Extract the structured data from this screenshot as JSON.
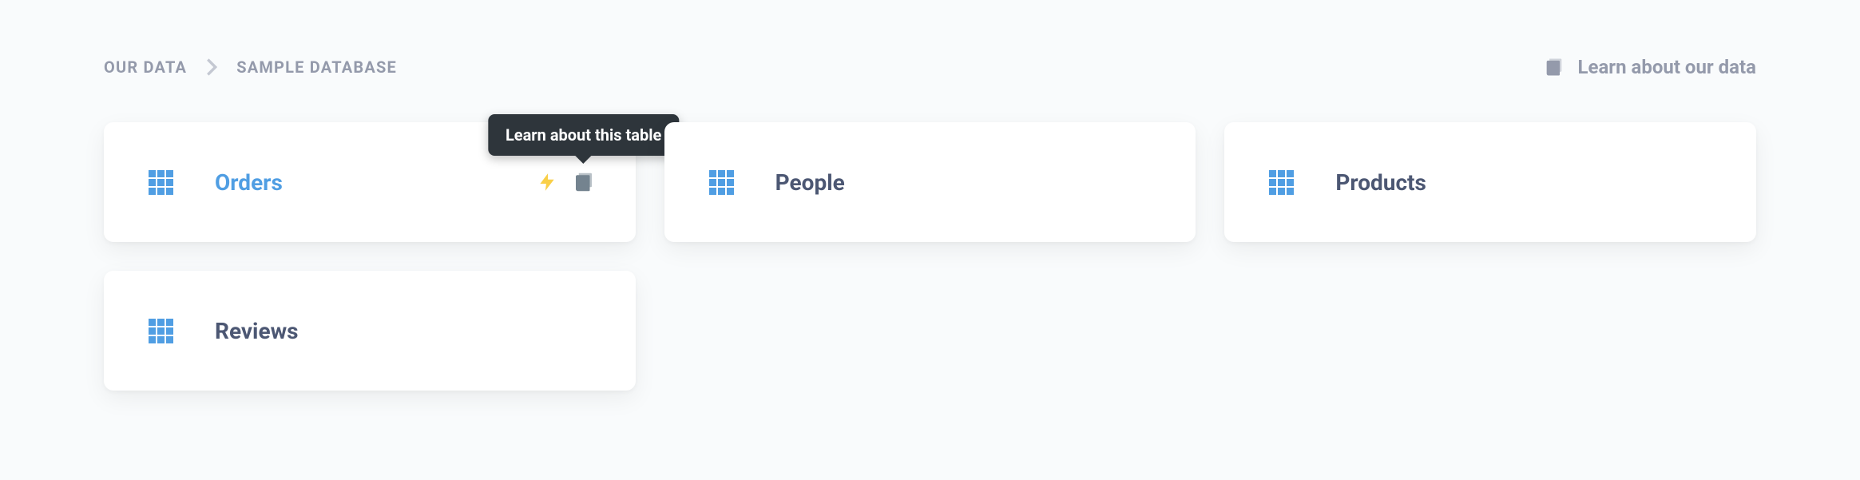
{
  "breadcrumb": {
    "root": "OUR DATA",
    "current": "SAMPLE DATABASE"
  },
  "learn_link": {
    "label": "Learn about our data"
  },
  "tooltip": {
    "label": "Learn about this table"
  },
  "tables": [
    {
      "name": "Orders",
      "active": true,
      "show_actions": true
    },
    {
      "name": "People",
      "active": false,
      "show_actions": false
    },
    {
      "name": "Products",
      "active": false,
      "show_actions": false
    },
    {
      "name": "Reviews",
      "active": false,
      "show_actions": false
    }
  ]
}
